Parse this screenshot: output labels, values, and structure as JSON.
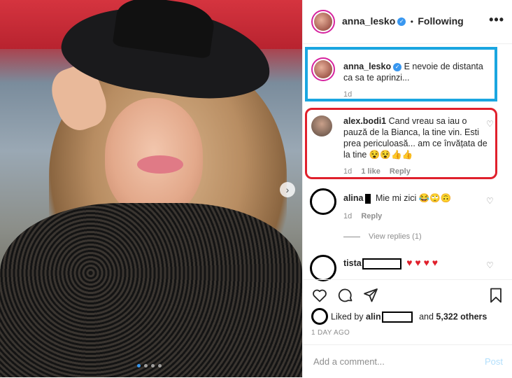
{
  "header": {
    "username": "anna_lesko",
    "separator": "•",
    "follow_label": "Following",
    "more_label": "•••"
  },
  "caption": {
    "username": "anna_lesko",
    "text": "E nevoie de distanta ca sa te aprinzi...",
    "time": "1d"
  },
  "comments": [
    {
      "username": "alex.bodi1",
      "text": "Cand vreau sa iau o pauză de la Bianca, la tine vin. Esti prea periculoasă... am ce învățata de la tine 😵😵👍👍",
      "time": "1d",
      "likes": "1 like",
      "reply": "Reply"
    },
    {
      "username": "alina",
      "text": "Mie mi zici 😂🙄🙃",
      "time": "1d",
      "reply": "Reply",
      "view_replies": "View replies (1)"
    },
    {
      "username": "tista",
      "text": "♥ ♥ ♥ ♥"
    }
  ],
  "likes": {
    "prefix": "Liked by",
    "name": "alin",
    "and": "and",
    "count": "5,322 others"
  },
  "date": "1 DAY AGO",
  "add_comment": {
    "placeholder": "Add a comment...",
    "post_label": "Post"
  },
  "icons": {
    "heart": "heart-icon",
    "comment": "comment-icon",
    "share": "share-icon",
    "save": "bookmark-icon"
  },
  "colors": {
    "verified": "#3897f0",
    "blue_box": "#1aa6e0",
    "red_box": "#e0202c"
  }
}
